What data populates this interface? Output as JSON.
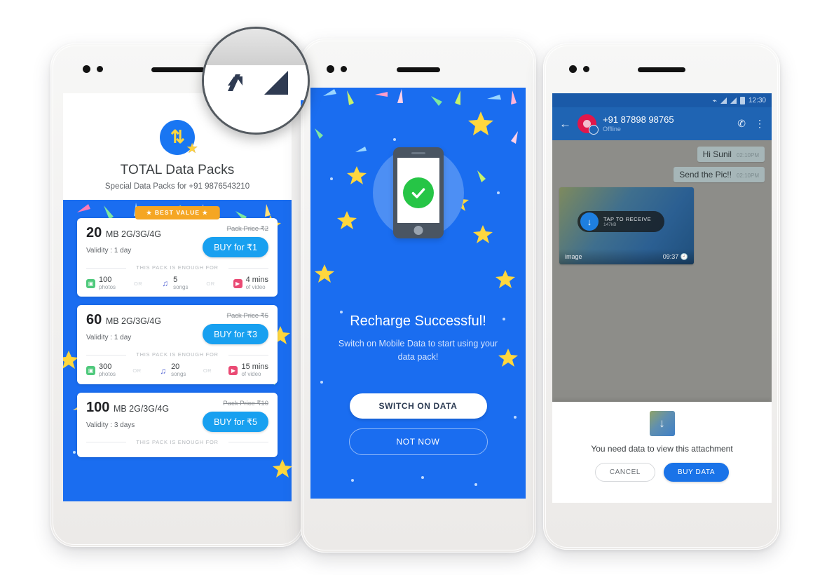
{
  "magnifier": {
    "icons": [
      "mobile-data-off-icon",
      "signal-bars-icon"
    ]
  },
  "left_phone": {
    "header": {
      "logo_icon": "data-transfer-star-icon",
      "arrows_glyph": "⇅",
      "star_glyph": "★",
      "title": "TOTAL Data Packs",
      "subtitle": "Special Data Packs for +91 9876543210"
    },
    "badge": {
      "label": "★ BEST VALUE ★"
    },
    "enough_for_label": "THIS PACK IS ENOUGH FOR",
    "or_separator": "OR",
    "packs": [
      {
        "size": "20",
        "unit": "MB 2G/3G/4G",
        "validity": "Validity : 1 day",
        "pack_price": "Pack Price ₹2",
        "buy_label": "BUY for ₹1",
        "usage": [
          {
            "icon": "photo-icon",
            "glyph": "▣",
            "amount": "100",
            "label": "photos"
          },
          {
            "icon": "music-note-icon",
            "glyph": "♫",
            "amount": "5",
            "label": "songs"
          },
          {
            "icon": "video-play-icon",
            "glyph": "▶",
            "amount": "4 mins",
            "label": "of video"
          }
        ]
      },
      {
        "size": "60",
        "unit": "MB 2G/3G/4G",
        "validity": "Validity : 1 day",
        "pack_price": "Pack Price ₹5",
        "buy_label": "BUY for ₹3",
        "usage": [
          {
            "icon": "photo-icon",
            "glyph": "▣",
            "amount": "300",
            "label": "photos"
          },
          {
            "icon": "music-note-icon",
            "glyph": "♫",
            "amount": "20",
            "label": "songs"
          },
          {
            "icon": "video-play-icon",
            "glyph": "▶",
            "amount": "15 mins",
            "label": "of video"
          }
        ]
      },
      {
        "size": "100",
        "unit": "MB 2G/3G/4G",
        "validity": "Validity : 3 days",
        "pack_price": "Pack Price ₹10",
        "buy_label": "BUY for ₹5",
        "usage": []
      }
    ]
  },
  "mid_phone": {
    "hero_icon": "phone-success-check-icon",
    "title": "Recharge Successful!",
    "subtitle": "Switch on Mobile Data to start using your data pack!",
    "primary_button": "SWITCH ON DATA",
    "secondary_button": "NOT NOW"
  },
  "right_phone": {
    "status_bar": {
      "time": "12:30",
      "icons": [
        "bluetooth-off-icon",
        "signal-bars-icon",
        "signal-bars-icon",
        "battery-icon"
      ]
    },
    "chat_header": {
      "back_icon": "back-arrow-icon",
      "avatar_icon": "contact-avatar-icon",
      "name": "+91 87898 98765",
      "status": "Offline",
      "call_icon": "phone-call-icon",
      "menu_icon": "overflow-menu-icon"
    },
    "messages": [
      {
        "text": "Hi Sunil",
        "meta": "02:10PM"
      },
      {
        "text": "Send the Pic!!",
        "meta": "02:10PM"
      }
    ],
    "attachment": {
      "tap_title": "TAP TO RECEIVE",
      "tap_size": "147kB",
      "download_icon": "download-arrow-icon",
      "caption": "image",
      "time": "09:37",
      "clock_icon": "clock-icon"
    },
    "sheet": {
      "thumb_icon": "download-arrow-icon",
      "message": "You need data to view this attachment",
      "cancel_label": "CANCEL",
      "buy_label": "BUY DATA"
    }
  },
  "colors": {
    "brand_blue": "#1a6df0",
    "button_blue": "#18a0f0",
    "badge_orange": "#f5a623",
    "success_green": "#26c546",
    "chat_header_blue": "#1f64b3",
    "accent_red": "#e0174b"
  }
}
